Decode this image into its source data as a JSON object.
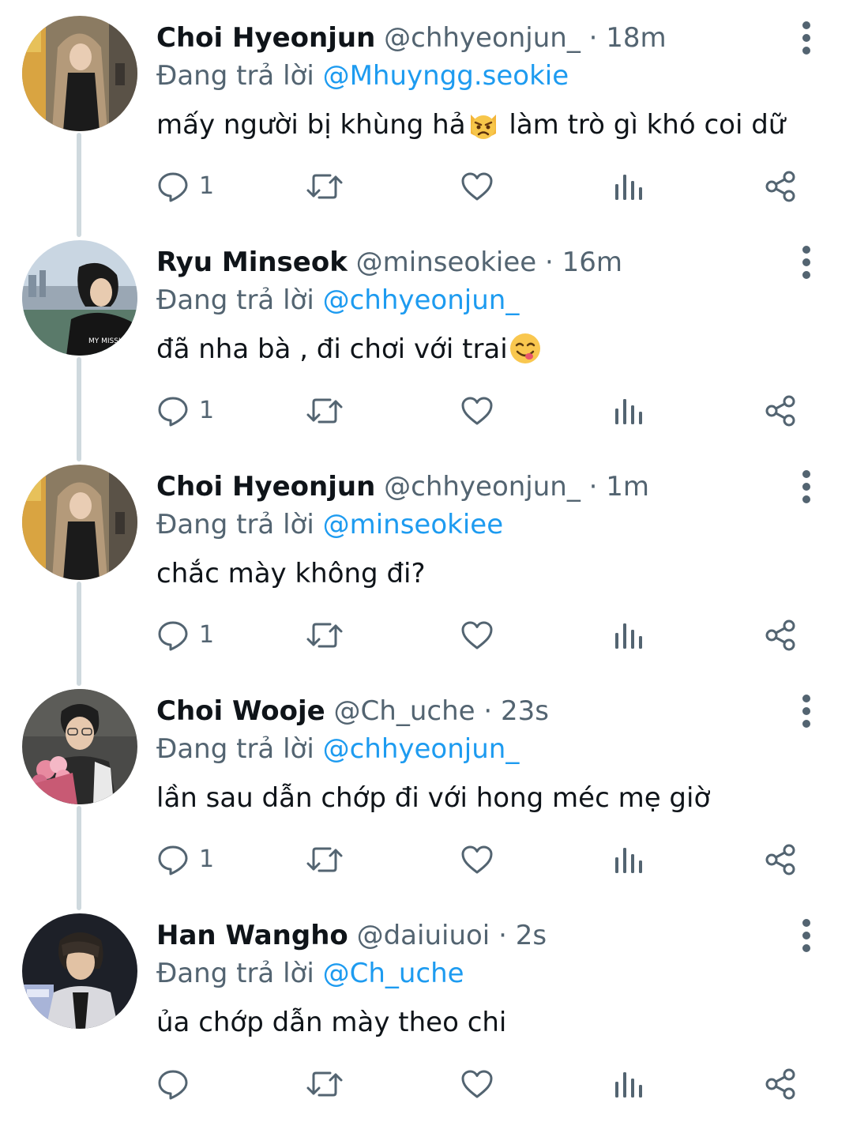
{
  "colors": {
    "text": "#0f1419",
    "muted": "#536471",
    "link": "#1d9bf0",
    "thread_line": "#cfd9de"
  },
  "tweets": [
    {
      "name": "Choi Hyeonjun",
      "handle": "@chhyeonjun_",
      "separator": "·",
      "time": "18m",
      "replying_prefix": "Đang trả lời",
      "replying_to": "@Mhuyngg.seokie",
      "text_before": "mấy người bị khùng hả",
      "emoji": "pouting-cat-emoji",
      "text_after": " làm trò gì khó coi dữ",
      "reply_count": "1",
      "avatar": "hooded-person-avatar"
    },
    {
      "name": "Ryu Minseok",
      "handle": "@minseokiee",
      "separator": "·",
      "time": "16m",
      "replying_prefix": "Đang trả lời",
      "replying_to": "@chhyeonjun_",
      "text_before": "đã nha bà , đi chơi với trai",
      "emoji": "savoring-food-emoji",
      "text_after": "",
      "reply_count": "1",
      "avatar": "person-city-avatar"
    },
    {
      "name": "Choi Hyeonjun",
      "handle": "@chhyeonjun_",
      "separator": "·",
      "time": "1m",
      "replying_prefix": "Đang trả lời",
      "replying_to": "@minseokiee",
      "text_before": "chắc mày không đi?",
      "emoji": "",
      "text_after": "",
      "reply_count": "1",
      "avatar": "hooded-person-avatar"
    },
    {
      "name": "Choi Wooje",
      "handle": "@Ch_uche",
      "separator": "·",
      "time": "23s",
      "replying_prefix": "Đang trả lời",
      "replying_to": "@chhyeonjun_",
      "text_before": "lần sau dẫn chớp đi với hong méc mẹ giờ",
      "emoji": "",
      "text_after": "",
      "reply_count": "1",
      "avatar": "person-flowers-avatar"
    },
    {
      "name": "Han Wangho",
      "handle": "@daiuiuoi",
      "separator": "·",
      "time": "2s",
      "replying_prefix": "Đang trả lời",
      "replying_to": "@Ch_uche",
      "text_before": "ủa chớp dẫn mày theo chi",
      "emoji": "",
      "text_after": "",
      "reply_count": "",
      "avatar": "person-dark-avatar"
    }
  ]
}
